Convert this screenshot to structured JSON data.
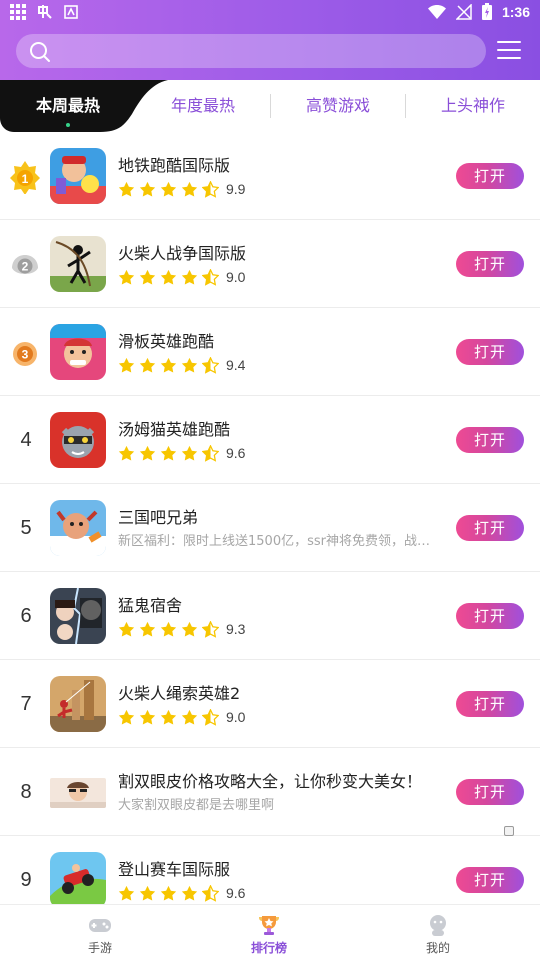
{
  "status_bar": {
    "time": "1:36"
  },
  "search": {
    "placeholder": ""
  },
  "tabs": [
    {
      "label": "本周最热",
      "active": true
    },
    {
      "label": "年度最热",
      "active": false
    },
    {
      "label": "高赞游戏",
      "active": false
    },
    {
      "label": "上头神作",
      "active": false
    }
  ],
  "list": [
    {
      "rank": "1",
      "name": "地铁跑酷国际版",
      "rating": "9.9",
      "button": "打开",
      "medal": "gold"
    },
    {
      "rank": "2",
      "name": "火柴人战争国际版",
      "rating": "9.0",
      "button": "打开",
      "medal": "silver"
    },
    {
      "rank": "3",
      "name": "滑板英雄跑酷",
      "rating": "9.4",
      "button": "打开",
      "medal": "bronze"
    },
    {
      "rank": "4",
      "name": "汤姆猫英雄跑酷",
      "rating": "9.6",
      "button": "打开"
    },
    {
      "rank": "5",
      "name": "三国吧兄弟",
      "desc": "新区福利：限时上线送1500亿，ssr神将免费领，战…",
      "button": "打开"
    },
    {
      "rank": "6",
      "name": "猛鬼宿舍",
      "rating": "9.3",
      "button": "打开"
    },
    {
      "rank": "7",
      "name": "火柴人绳索英雄2",
      "rating": "9.0",
      "button": "打开"
    },
    {
      "rank": "8",
      "name": "割双眼皮价格攻略大全，让你秒变大美女！",
      "desc": "大家割双眼皮都是去哪里啊",
      "button": "打开",
      "ad": true
    },
    {
      "rank": "9",
      "name": "登山赛车国际服",
      "rating": "9.6",
      "button": "打开"
    }
  ],
  "bottom_nav": [
    {
      "label": "手游",
      "icon": "gamepad-icon",
      "active": false
    },
    {
      "label": "排行榜",
      "icon": "trophy-icon",
      "active": true
    },
    {
      "label": "我的",
      "icon": "profile-icon",
      "active": false
    }
  ],
  "colors": {
    "header_start": "#b868ea",
    "header_end": "#8a4fe2",
    "accent_purple": "#8a4fd8",
    "button_pink": "#ee4a93",
    "button_purple": "#a050dc",
    "star_yellow": "#f7c600",
    "active_tab_bg": "#111111"
  }
}
